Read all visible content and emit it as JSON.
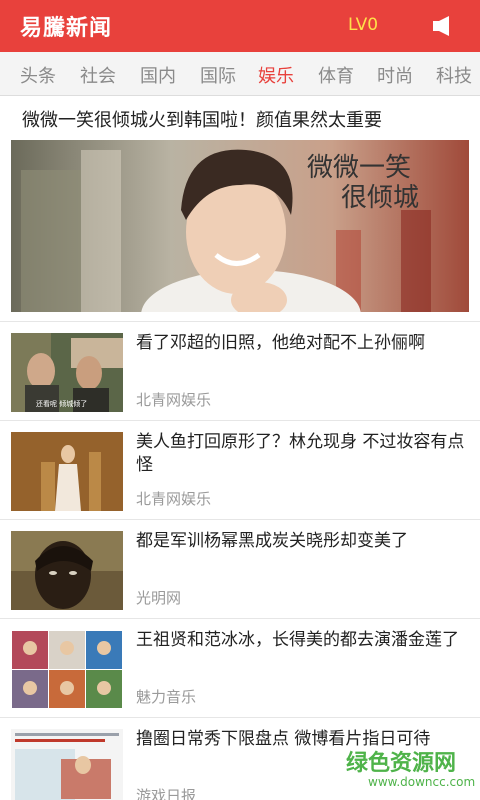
{
  "header": {
    "title": "易騰新闻",
    "level": "LV0",
    "icon": "speaker-icon"
  },
  "tabs": [
    {
      "label": "头条",
      "active": false
    },
    {
      "label": "社会",
      "active": false
    },
    {
      "label": "国内",
      "active": false
    },
    {
      "label": "国际",
      "active": false
    },
    {
      "label": "娱乐",
      "active": true
    },
    {
      "label": "体育",
      "active": false
    },
    {
      "label": "时尚",
      "active": false
    },
    {
      "label": "科技",
      "active": false
    }
  ],
  "featured": {
    "headline": "微微一笑很倾城火到韩国啦！颜值果然太重要",
    "image_caption": "微微一笑很倾城"
  },
  "news": [
    {
      "title": "看了邓超的旧照，他绝对配不上孙俪啊",
      "source": "北青网娱乐",
      "thumb_caption": "还看呢  倾城倾了"
    },
    {
      "title": "美人鱼打回原形了？林允现身 不过妆容有点怪",
      "source": "北青网娱乐"
    },
    {
      "title": "都是军训杨幂黑成炭关晓彤却变美了",
      "source": "光明网"
    },
    {
      "title": "王祖贤和范冰冰，长得美的都去演潘金莲了",
      "source": "魅力音乐"
    },
    {
      "title": "撸圈日常秀下限盘点 微博看片指日可待",
      "source": "游戏日报"
    }
  ],
  "watermark": {
    "name": "绿色资源网",
    "url": "www.downcc.com"
  },
  "colors": {
    "accent": "#e8413c",
    "level": "#ffe14a",
    "watermark": "#4fb34a"
  }
}
